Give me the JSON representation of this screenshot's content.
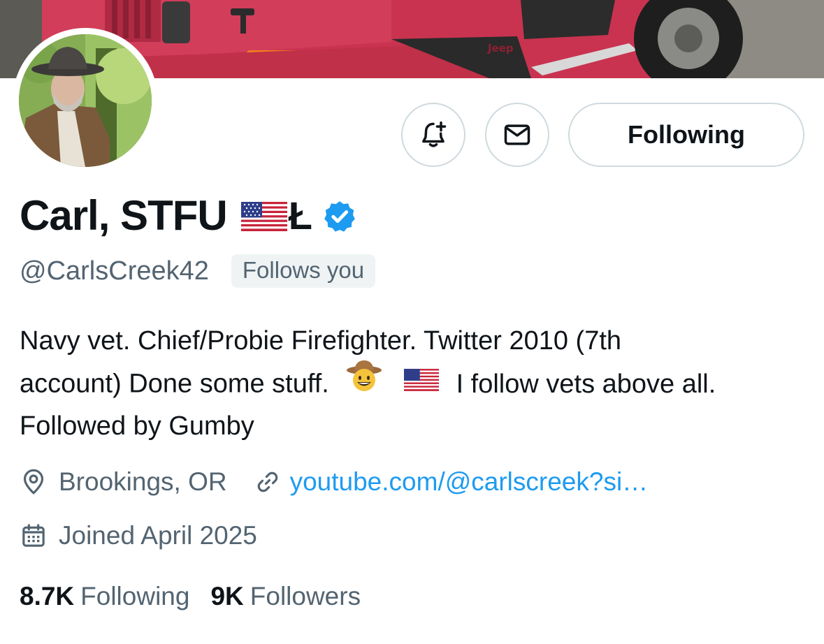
{
  "banner": {
    "jeep_badge_text": "Jeep"
  },
  "actions": {
    "notify_icon": "bell-plus-icon",
    "message_icon": "envelope-icon",
    "follow_label": "Following"
  },
  "profile": {
    "display_name": "Carl, STFU",
    "name_suffix": "Ł",
    "flag_emoji": "us-flag",
    "verified": true,
    "verified_color": "#1d9bf0",
    "handle": "@CarlsCreek42",
    "follows_you_label": "Follows you"
  },
  "bio": {
    "line1": "Navy vet. Chief/Probie Firefighter. Twitter 2010 (7th",
    "line2_a": "account) Done some stuff.",
    "line2_b": "I follow vets above all.",
    "line3": "Followed by Gumby",
    "emoji_1": "cowboy-hat-face",
    "emoji_2": "us-flag"
  },
  "meta": {
    "location_icon": "map-pin-icon",
    "location": "Brookings, OR",
    "link_icon": "link-icon",
    "link_text": "youtube.com/@carlscreek?si…",
    "joined_icon": "calendar-icon",
    "joined": "Joined April 2025"
  },
  "stats": {
    "following_count": "8.7K",
    "following_label": "Following",
    "followers_count": "9K",
    "followers_label": "Followers"
  },
  "colors": {
    "accent": "#1d9bf0",
    "text_primary": "#0f1419",
    "text_secondary": "#536471",
    "border": "#cfd9de",
    "badge_bg": "#eff3f4"
  }
}
